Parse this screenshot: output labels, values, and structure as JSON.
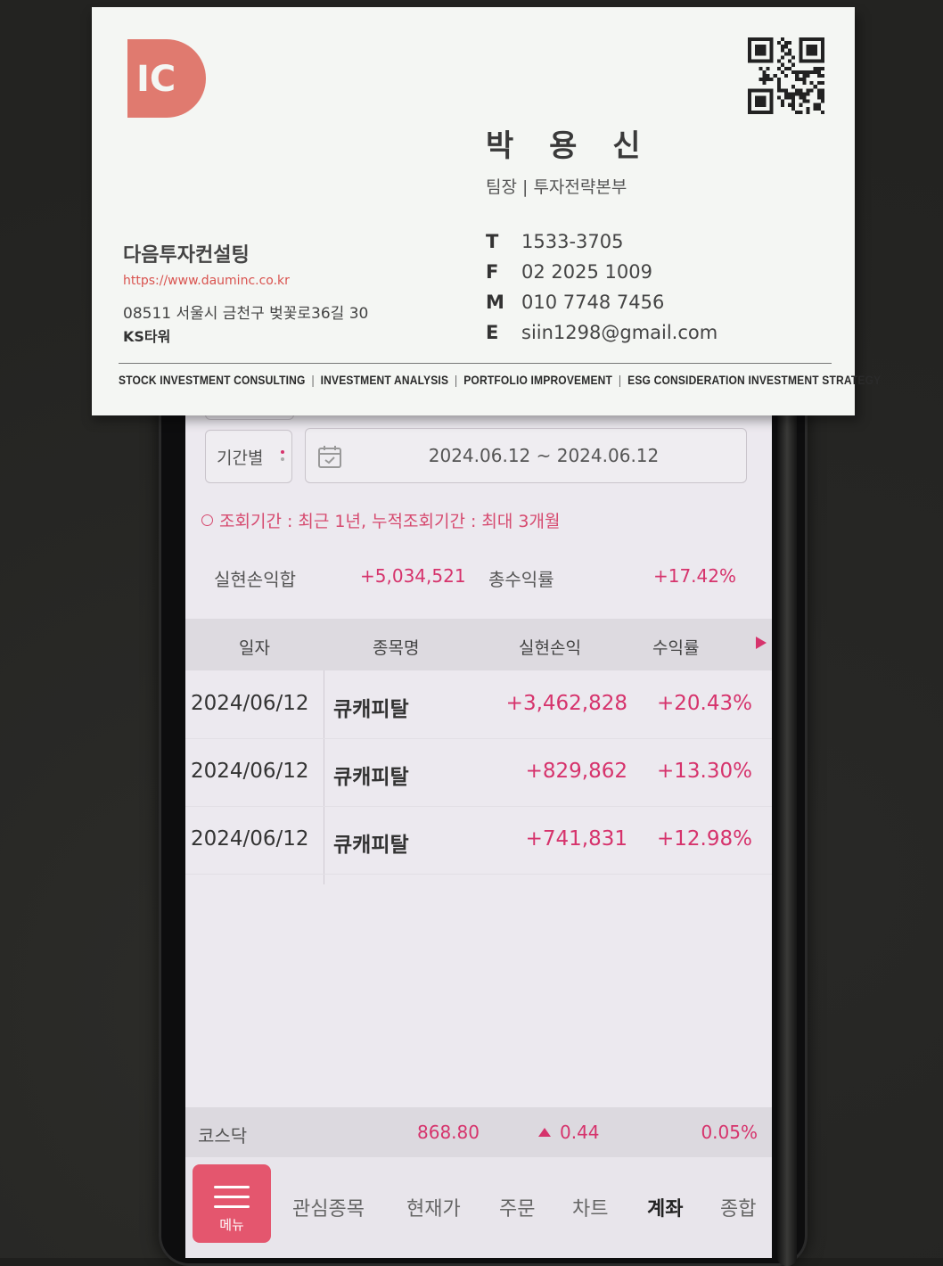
{
  "card": {
    "logo_text": "IC",
    "name": "박 용 신",
    "title": "팀장 | 투자전략본부",
    "company": "다음투자컨설팅",
    "url": "https://www.dauminc.co.kr",
    "address": "08511 서울시 금천구 벚꽃로36길 30",
    "building": "KS타워",
    "contacts": [
      {
        "label": "T",
        "value": "1533-3705"
      },
      {
        "label": "F",
        "value": "02 2025 1009"
      },
      {
        "label": "M",
        "value": "010 7748 7456"
      },
      {
        "label": "E",
        "value": "siin1298@gmail.com"
      }
    ],
    "tagline": [
      "STOCK INVESTMENT CONSULTING",
      "INVESTMENT ANALYSIS",
      "PORTFOLIO IMPROVEMENT",
      "ESG CONSIDERATION INVESTMENT STRATEGY"
    ],
    "accent_color": "#d9534f"
  },
  "app": {
    "period_label": "기간별",
    "date_range": "2024.06.12 ~ 2024.06.12",
    "notice": "조회기간 : 최근 1년, 누적조회기간 : 최대 3개월",
    "summary": {
      "realized_label": "실현손익합",
      "realized_value": "+5,034,521",
      "return_label": "총수익률",
      "return_value": "+17.42%"
    },
    "table": {
      "headers": [
        "일자",
        "종목명",
        "실현손익",
        "수익률"
      ],
      "rows": [
        {
          "date": "2024/06/12",
          "stock": "큐캐피탈",
          "pl": "+3,462,828",
          "rate": "+20.43%"
        },
        {
          "date": "2024/06/12",
          "stock": "큐캐피탈",
          "pl": "+829,862",
          "rate": "+13.30%"
        },
        {
          "date": "2024/06/12",
          "stock": "큐캐피탈",
          "pl": "+741,831",
          "rate": "+12.98%"
        }
      ]
    },
    "index": {
      "name": "코스닥",
      "value": "868.80",
      "change": "0.44",
      "change_pct": "0.05%"
    },
    "nav": {
      "menu_label": "메뉴",
      "items": [
        "관심종목",
        "현재가",
        "주문",
        "차트",
        "계좌",
        "종합"
      ],
      "active": "계좌"
    },
    "accent_color": "#d6336c"
  }
}
